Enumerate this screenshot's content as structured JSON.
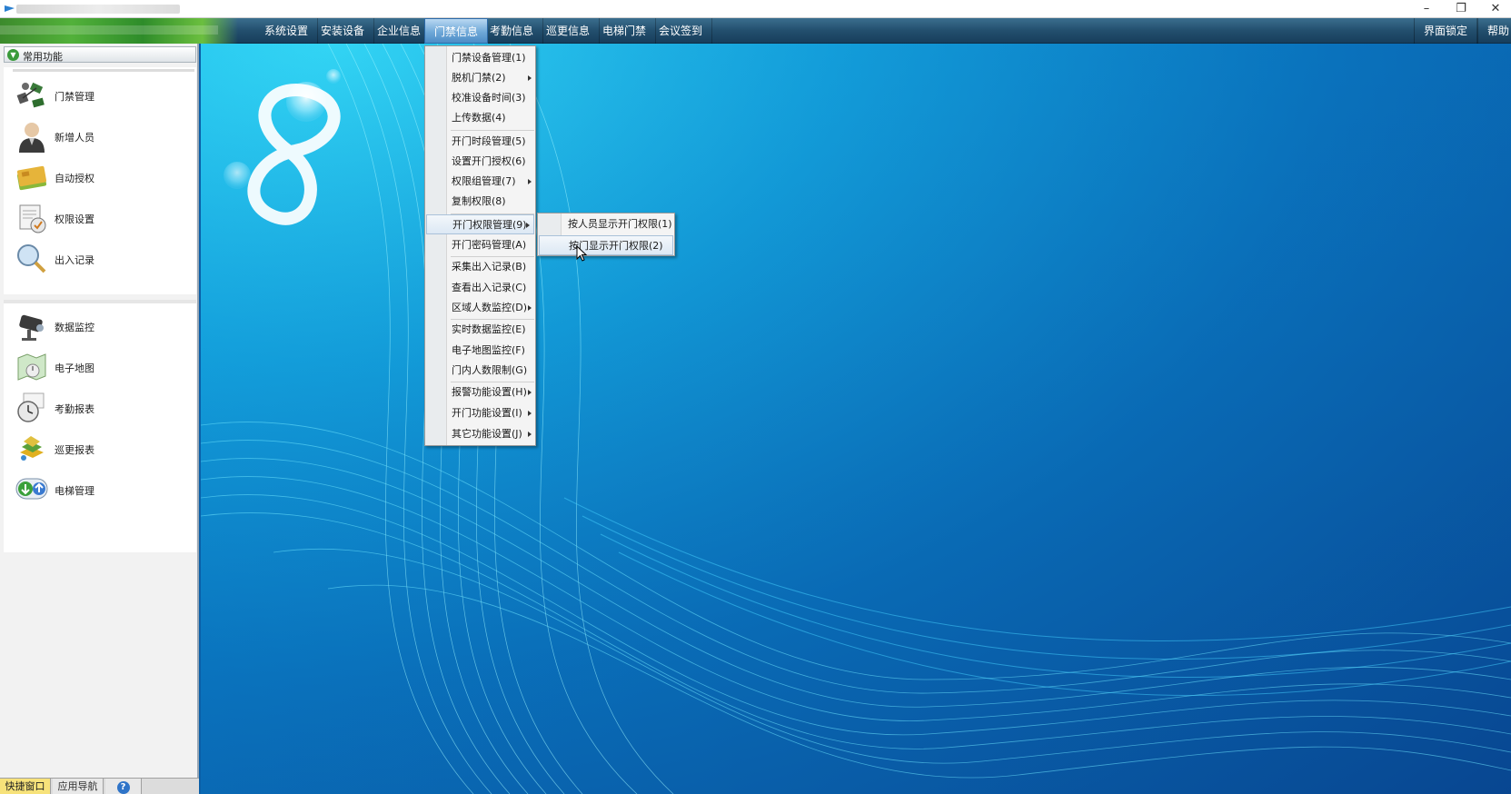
{
  "window": {
    "minimize_glyph": "–",
    "maximize_glyph": "❐",
    "close_glyph": "✕"
  },
  "menubar": {
    "items": [
      {
        "label": "系统设置"
      },
      {
        "label": "安装设备"
      },
      {
        "label": "企业信息"
      },
      {
        "label": "门禁信息",
        "active": true
      },
      {
        "label": "考勤信息"
      },
      {
        "label": "巡更信息"
      },
      {
        "label": "电梯门禁"
      },
      {
        "label": "会议签到"
      }
    ],
    "right_items": [
      {
        "label": "界面锁定"
      },
      {
        "label": "帮助"
      }
    ]
  },
  "sidebar": {
    "header": "常用功能",
    "group1": [
      {
        "label": "门禁管理",
        "icon": "door-control-icon"
      },
      {
        "label": "新增人员",
        "icon": "person-icon"
      },
      {
        "label": "自动授权",
        "icon": "card-icon"
      },
      {
        "label": "权限设置",
        "icon": "permission-icon"
      },
      {
        "label": "出入记录",
        "icon": "magnifier-icon"
      }
    ],
    "group2": [
      {
        "label": "数据监控",
        "icon": "camera-icon"
      },
      {
        "label": "电子地图",
        "icon": "map-icon"
      },
      {
        "label": "考勤报表",
        "icon": "clock-icon"
      },
      {
        "label": "巡更报表",
        "icon": "patrol-icon"
      },
      {
        "label": "电梯管理",
        "icon": "elevator-icon"
      }
    ]
  },
  "bottom_tabs": {
    "quick": "快捷窗口",
    "nav": "应用导航",
    "help": "?"
  },
  "dropdown": {
    "items": [
      {
        "label": "门禁设备管理(1)"
      },
      {
        "label": "脱机门禁(2)",
        "submenu": true
      },
      {
        "label": "校准设备时间(3)"
      },
      {
        "label": "上传数据(4)"
      },
      {
        "label": "开门时段管理(5)"
      },
      {
        "label": "设置开门授权(6)"
      },
      {
        "label": "权限组管理(7)",
        "submenu": true
      },
      {
        "label": "复制权限(8)"
      },
      {
        "label": "开门权限管理(9)",
        "submenu": true,
        "highlighted": true
      },
      {
        "label": "开门密码管理(A)"
      },
      {
        "label": "采集出入记录(B)"
      },
      {
        "label": "查看出入记录(C)"
      },
      {
        "label": "区域人数监控(D)",
        "submenu": true
      },
      {
        "label": "实时数据监控(E)"
      },
      {
        "label": "电子地图监控(F)"
      },
      {
        "label": "门内人数限制(G)"
      },
      {
        "label": "报警功能设置(H)",
        "submenu": true
      },
      {
        "label": "开门功能设置(I)",
        "submenu": true
      },
      {
        "label": "其它功能设置(J)",
        "submenu": true
      }
    ]
  },
  "submenu": {
    "items": [
      {
        "label": "按人员显示开门权限(1)"
      },
      {
        "label": "按门显示开门权限(2)",
        "highlighted": true
      }
    ]
  },
  "colors": {
    "menubar_bg": "#234f6e",
    "accent_highlight": "#dce8f4",
    "quick_tab": "#f7e27a"
  }
}
